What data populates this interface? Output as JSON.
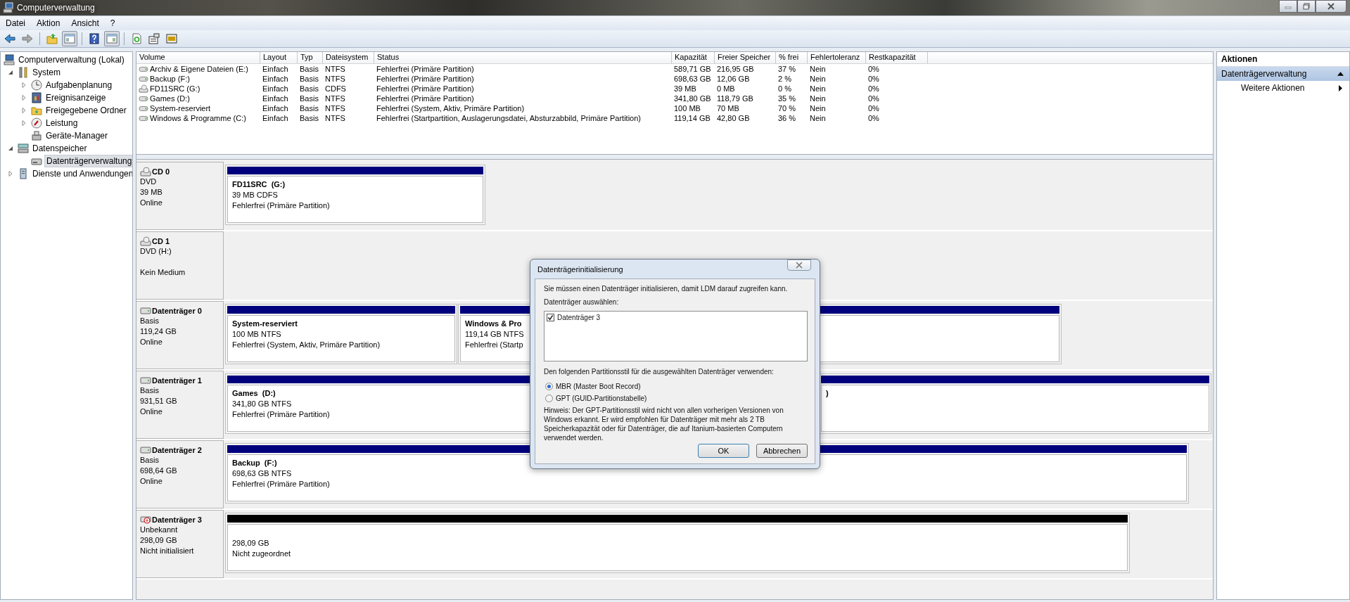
{
  "window": {
    "title": "Computerverwaltung"
  },
  "menu": [
    "Datei",
    "Aktion",
    "Ansicht",
    "?"
  ],
  "toolbar": [
    {
      "pressed": false
    },
    {
      "pressed": false
    },
    {
      "pressed": false
    },
    {
      "pressed": true
    },
    {
      "pressed": false
    },
    {
      "pressed": true
    },
    {
      "pressed": false
    },
    {
      "pressed": false
    },
    {
      "pressed": false
    }
  ],
  "tree": [
    {
      "label": "Computerverwaltung (Lokal)",
      "selected": false,
      "children": [
        {
          "label": "System",
          "expanded": true,
          "selected": false,
          "children": [
            {
              "label": "Aufgabenplanung",
              "expanded": false,
              "selected": false
            },
            {
              "label": "Ereignisanzeige",
              "expanded": false,
              "selected": false
            },
            {
              "label": "Freigegebene Ordner",
              "expanded": false,
              "selected": false
            },
            {
              "label": "Leistung",
              "expanded": false,
              "selected": false
            },
            {
              "label": "Geräte-Manager",
              "selected": false
            }
          ]
        },
        {
          "label": "Datenspeicher",
          "expanded": true,
          "selected": false,
          "children": [
            {
              "label": "Datenträgerverwaltung",
              "selected": true
            }
          ]
        },
        {
          "label": "Dienste und Anwendungen",
          "expanded": false,
          "selected": false
        }
      ]
    }
  ],
  "table": {
    "columns": [
      "Volume",
      "Layout",
      "Typ",
      "Dateisystem",
      "Status",
      "Kapazität",
      "Freier Speicher",
      "% frei",
      "Fehlertoleranz",
      "Restkapazität"
    ],
    "rows": [
      {
        "kind": "fixed",
        "cells": [
          "Archiv & Eigene Dateien (E:)",
          "Einfach",
          "Basis",
          "NTFS",
          "Fehlerfrei (Primäre Partition)",
          "589,71 GB",
          "216,95 GB",
          "37 %",
          "Nein",
          "0%"
        ]
      },
      {
        "kind": "fixed",
        "cells": [
          "Backup (F:)",
          "Einfach",
          "Basis",
          "NTFS",
          "Fehlerfrei (Primäre Partition)",
          "698,63 GB",
          "12,06 GB",
          "2 %",
          "Nein",
          "0%"
        ]
      },
      {
        "kind": "optical",
        "cells": [
          "FD11SRC (G:)",
          "Einfach",
          "Basis",
          "CDFS",
          "Fehlerfrei (Primäre Partition)",
          "39 MB",
          "0 MB",
          "0 %",
          "Nein",
          "0%"
        ]
      },
      {
        "kind": "fixed",
        "cells": [
          "Games (D:)",
          "Einfach",
          "Basis",
          "NTFS",
          "Fehlerfrei (Primäre Partition)",
          "341,80 GB",
          "118,79 GB",
          "35 %",
          "Nein",
          "0%"
        ]
      },
      {
        "kind": "fixed",
        "cells": [
          "System-reserviert",
          "Einfach",
          "Basis",
          "NTFS",
          "Fehlerfrei (System, Aktiv, Primäre Partition)",
          "100 MB",
          "70 MB",
          "70 %",
          "Nein",
          "0%"
        ]
      },
      {
        "kind": "fixed",
        "cells": [
          "Windows & Programme (C:)",
          "Einfach",
          "Basis",
          "NTFS",
          "Fehlerfrei (Startpartition, Auslagerungsdatei, Absturzabbild, Primäre Partition)",
          "119,14 GB",
          "42,80 GB",
          "36 %",
          "Nein",
          "0%"
        ]
      }
    ]
  },
  "disks": [
    {
      "kind": "optical",
      "name": "CD 0",
      "type": "DVD",
      "size": "39 MB",
      "status": "Online",
      "partitions": [
        {
          "kind": "primary",
          "name": "FD11SRC  (G:)",
          "size": "39 MB CDFS",
          "status": "Fehlerfrei (Primäre Partition)"
        }
      ]
    },
    {
      "kind": "optical",
      "name": "CD 1",
      "type": "DVD (H:)",
      "status": "Kein Medium"
    },
    {
      "kind": "basic",
      "name": "Datenträger 0",
      "type": "Basis",
      "size": "119,24 GB",
      "status": "Online",
      "partitions": [
        {
          "kind": "primary",
          "name": "System-reserviert",
          "size": "100 MB NTFS",
          "status": "Fehlerfrei (System, Aktiv, Primäre Partition)"
        },
        {
          "kind": "primary",
          "name": "Windows & Pro",
          "size": "119,14 GB NTFS",
          "status": "Fehlerfrei (Startp"
        }
      ]
    },
    {
      "kind": "basic",
      "name": "Datenträger 1",
      "type": "Basis",
      "size": "931,51 GB",
      "status": "Online",
      "partitions": [
        {
          "kind": "primary",
          "name": "Games  (D:)",
          "size": "341,80 GB NTFS",
          "status": "Fehlerfrei (Primäre Partition)"
        },
        {
          "kind": "primary",
          "name": ")"
        }
      ]
    },
    {
      "kind": "basic",
      "name": "Datenträger 2",
      "type": "Basis",
      "size": "698,64 GB",
      "status": "Online",
      "partitions": [
        {
          "kind": "primary",
          "name": "Backup  (F:)",
          "size": "698,63 GB NTFS",
          "status": "Fehlerfrei (Primäre Partition)"
        }
      ]
    },
    {
      "kind": "unknown",
      "name": "Datenträger 3",
      "type": "Unbekannt",
      "size": "298,09 GB",
      "status": "Nicht initialisiert",
      "partitions": [
        {
          "kind": "unallocated",
          "size": "298,09 GB",
          "status": "Nicht zugeordnet"
        }
      ]
    }
  ],
  "actions": {
    "title": "Aktionen",
    "section": "Datenträgerverwaltung",
    "section_expanded": true,
    "items": [
      "Weitere Aktionen"
    ]
  },
  "dialog": {
    "title": "Datenträgerinitialisierung",
    "intro": "Sie müssen einen Datenträger initialisieren, damit LDM darauf zugreifen kann.",
    "list_label": "Datenträger auswählen:",
    "disks": [
      {
        "label": "Datenträger 3",
        "checked": true
      }
    ],
    "style_label": "Den folgenden Partitionsstil für die ausgewählten Datenträger verwenden:",
    "styles": [
      {
        "label": "MBR (Master Boot Record)",
        "selected": true
      },
      {
        "label": "GPT (GUID-Partitionstabelle)",
        "selected": false
      }
    ],
    "note": "Hinweis: Der GPT-Partitionsstil wird nicht von allen vorherigen Versionen von Windows erkannt. Er wird empfohlen für Datenträger mit mehr als 2 TB Speicherkapazität oder für Datenträger, die auf Itanium-basierten Computern verwendet werden.",
    "buttons": [
      "OK",
      "Abbrechen"
    ]
  }
}
